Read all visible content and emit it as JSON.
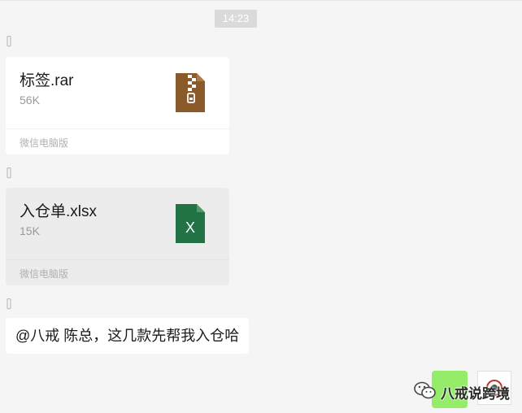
{
  "timestamp": "14:23",
  "messages": [
    {
      "type": "file",
      "file_name": "标签.rar",
      "file_size": "56K",
      "source": "微信电脑版",
      "icon": "archive-file-icon",
      "icon_color": "#8b5a2b"
    },
    {
      "type": "file",
      "file_name": "入仓单.xlsx",
      "file_size": "15K",
      "source": "微信电脑版",
      "icon": "excel-file-icon",
      "icon_color": "#217346",
      "icon_letter": "X"
    },
    {
      "type": "text",
      "text": "@八戒 陈总，这几款先帮我入仓哈"
    }
  ],
  "watermark": {
    "text": "八戒说跨境",
    "icon": "wechat-icon"
  },
  "colors": {
    "background": "#f5f5f5",
    "self_bubble": "#95ec69",
    "timestamp_bg": "#dadada"
  }
}
